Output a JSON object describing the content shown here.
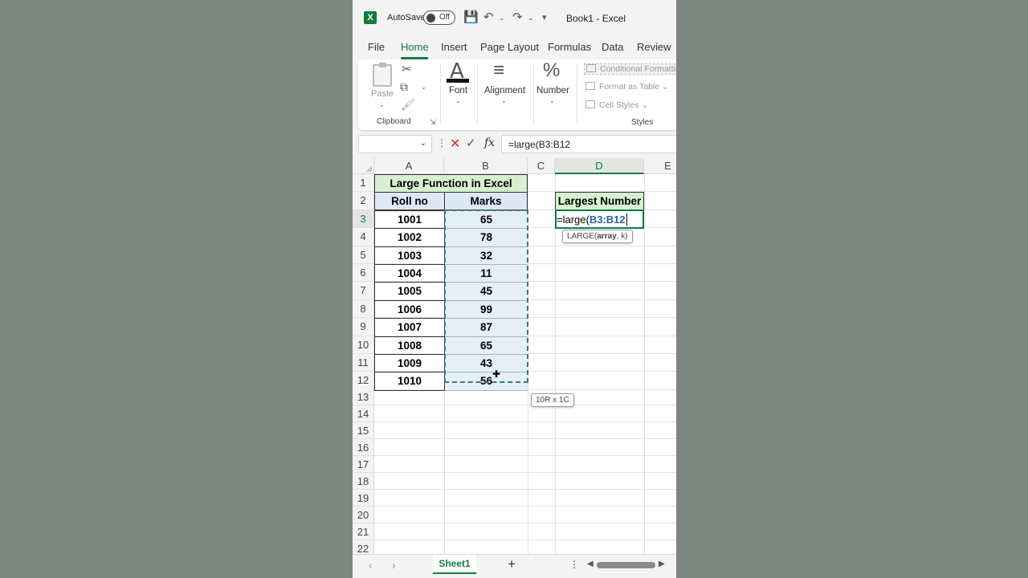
{
  "titlebar": {
    "autosave_label": "AutoSave",
    "autosave_state": "Off",
    "doc_title": "Book1 - Excel"
  },
  "tabs": [
    "File",
    "Home",
    "Insert",
    "Page Layout",
    "Formulas",
    "Data",
    "Review"
  ],
  "ribbon": {
    "paste_label": "Paste",
    "clipboard_label": "Clipboard",
    "font_label": "Font",
    "alignment_label": "Alignment",
    "number_label": "Number",
    "conditional_formatting": "Conditional Formatting",
    "format_as_table": "Format as Table",
    "cell_styles": "Cell Styles",
    "styles_label": "Styles"
  },
  "formula_bar": {
    "namebox": "",
    "formula": "=large(B3:B12"
  },
  "columns": [
    "A",
    "B",
    "C",
    "D",
    "E"
  ],
  "rows": [
    "1",
    "2",
    "3",
    "4",
    "5",
    "6",
    "7",
    "8",
    "9",
    "10",
    "11",
    "12",
    "13",
    "14",
    "15",
    "16",
    "17",
    "18",
    "19",
    "20",
    "21",
    "22"
  ],
  "sheet": {
    "title": "Large Function in Excel",
    "headers": [
      "Roll no",
      "Marks"
    ],
    "data": [
      [
        "1001",
        "65"
      ],
      [
        "1002",
        "78"
      ],
      [
        "1003",
        "32"
      ],
      [
        "1004",
        "11"
      ],
      [
        "1005",
        "45"
      ],
      [
        "1006",
        "99"
      ],
      [
        "1007",
        "87"
      ],
      [
        "1008",
        "65"
      ],
      [
        "1009",
        "43"
      ],
      [
        "1010",
        "56"
      ]
    ],
    "d2_header": "Largest Number",
    "d3_prefix": "=large(",
    "d3_ref": "B3:B12"
  },
  "tooltips": {
    "fn_name": "LARGE(",
    "fn_arg1": "array",
    "fn_rest": ", k)",
    "selection_size": "10R x 1C"
  },
  "sheet_tabs": {
    "active": "Sheet1"
  },
  "colors": {
    "accent": "#107c41",
    "title_fill": "#d8f0d0",
    "header_fill": "#dce8f5",
    "ref_blue": "#2e5fad"
  }
}
